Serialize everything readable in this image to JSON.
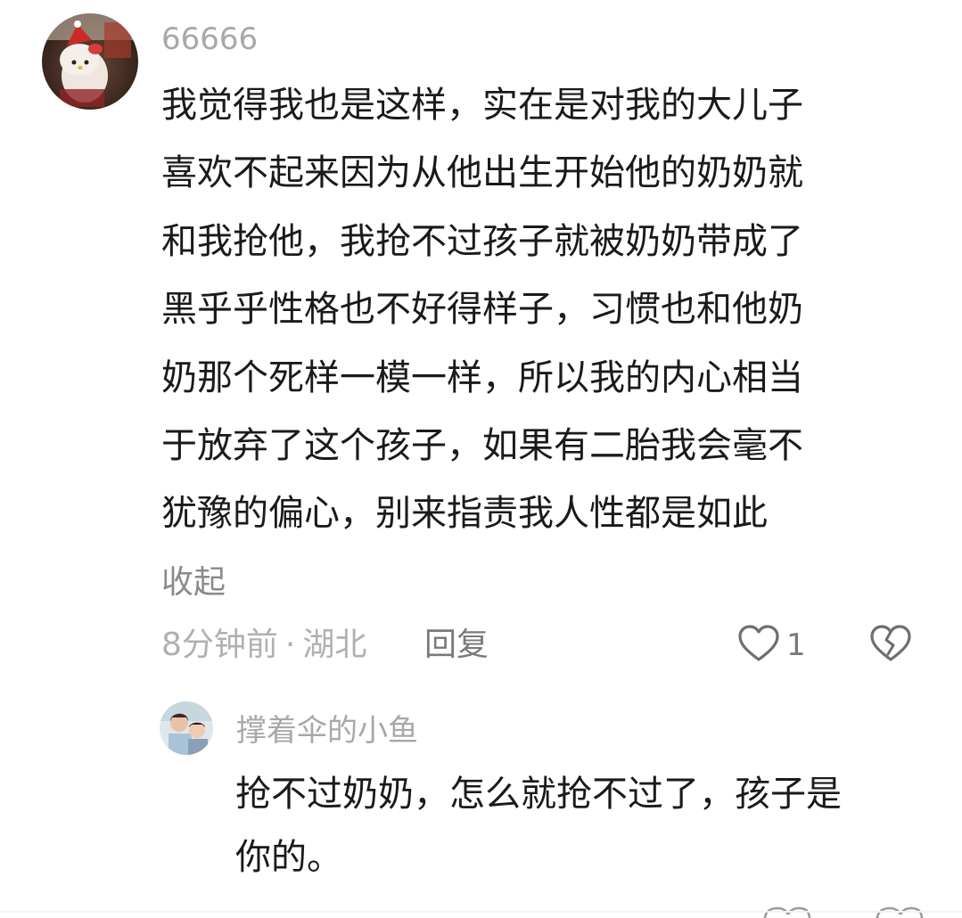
{
  "comment": {
    "username": "66666",
    "text_lines": [
      "我觉得我也是这样，实在是对我的大儿子",
      "喜欢不起来因为从他出生开始他的奶奶就",
      "和我抢他，我抢不过孩子就被奶奶带成了",
      "黑乎乎性格也不好得样子，习惯也和他奶",
      "奶那个死样一模一样，所以我的内心相当",
      "于放弃了这个孩子，如果有二胎我会毫不",
      "犹豫的偏心，别来指责我人性都是如此"
    ],
    "collapse_label": "收起",
    "time": "8分钟前",
    "separator": "·",
    "location": "湖北",
    "reply_label": "回复",
    "like_count": "1",
    "like_icon": "heart-outline-icon",
    "dislike_icon": "broken-heart-icon"
  },
  "reply": {
    "username": "撑着伞的小鱼",
    "text_lines": [
      "抢不过奶奶，怎么就抢不过了，孩子是",
      "你的。"
    ]
  },
  "colors": {
    "text_primary": "#1a1a1a",
    "text_secondary": "#a8a8a8",
    "background": "#ffffff"
  }
}
